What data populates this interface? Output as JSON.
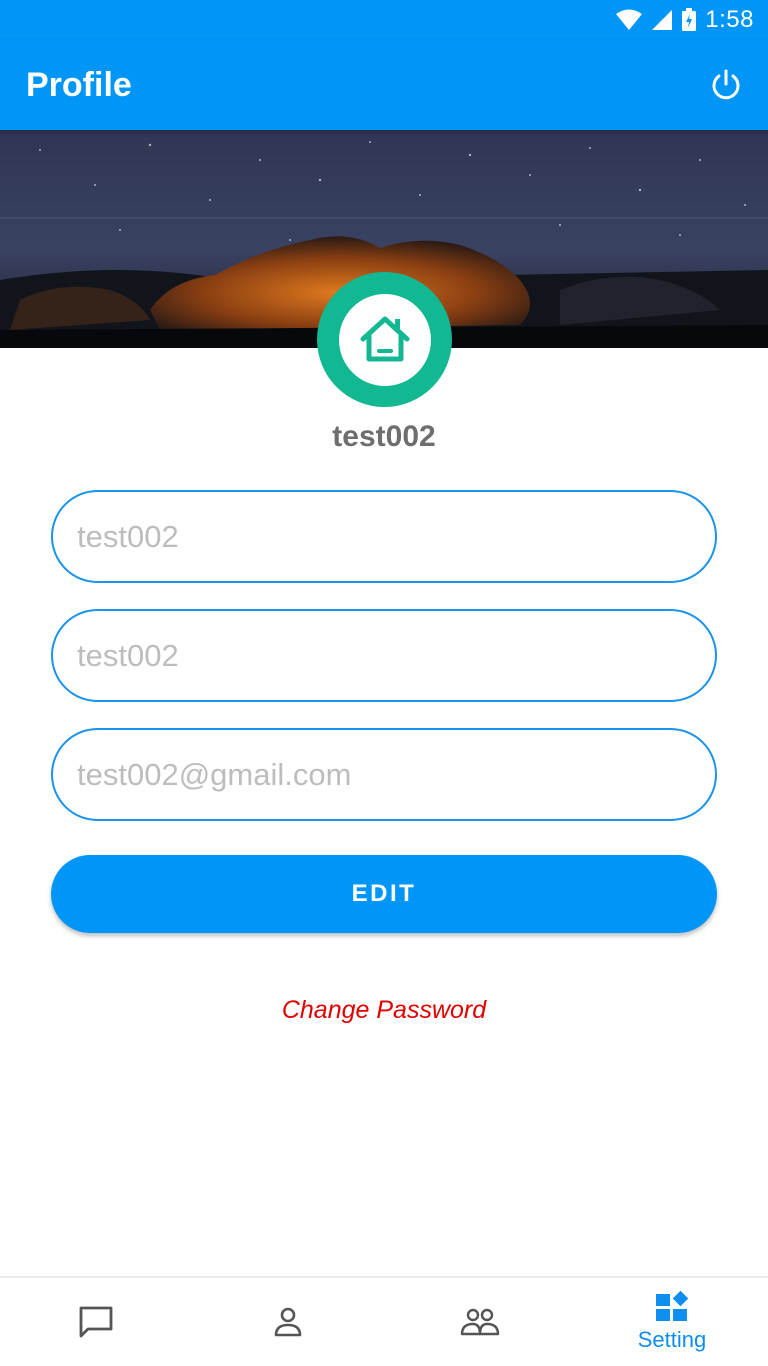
{
  "status_bar": {
    "time": "1:58"
  },
  "app_bar": {
    "title": "Profile"
  },
  "profile": {
    "username": "test002"
  },
  "form": {
    "fields": [
      {
        "value": "",
        "placeholder": "test002"
      },
      {
        "value": "",
        "placeholder": "test002"
      },
      {
        "value": "",
        "placeholder": "test002@gmail.com"
      }
    ],
    "edit_label": "EDIT",
    "change_password_label": "Change Password"
  },
  "bottom_nav": {
    "items": [
      {
        "icon": "chat-icon",
        "label": ""
      },
      {
        "icon": "person-icon",
        "label": ""
      },
      {
        "icon": "people-icon",
        "label": ""
      },
      {
        "icon": "dashboard-icon",
        "label": "Setting",
        "active": true
      }
    ]
  },
  "colors": {
    "primary": "#0096f7",
    "avatar": "#12b892",
    "link_red": "#e00000",
    "placeholder": "#bdbdbd"
  }
}
